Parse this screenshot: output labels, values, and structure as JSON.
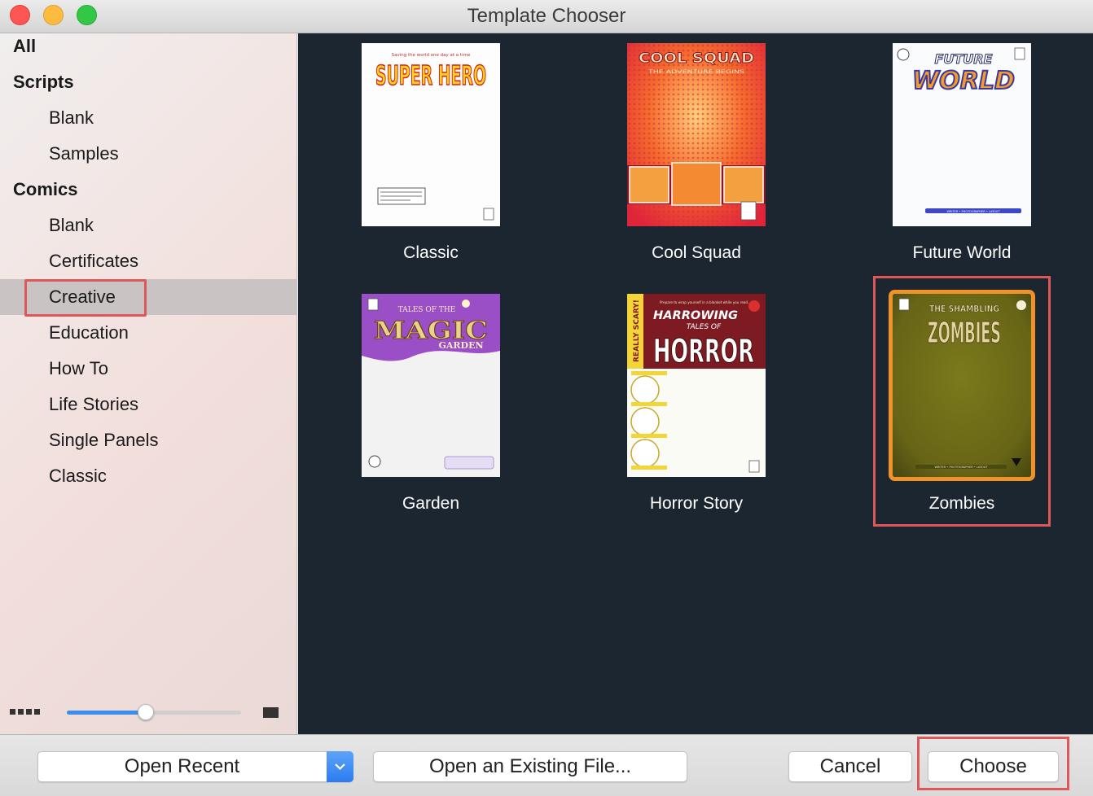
{
  "window": {
    "title": "Template Chooser"
  },
  "sidebar": {
    "items": [
      {
        "label": "All",
        "level": "header",
        "selected": false
      },
      {
        "label": "Scripts",
        "level": "header",
        "selected": false
      },
      {
        "label": "Blank",
        "level": "child",
        "selected": false
      },
      {
        "label": "Samples",
        "level": "child",
        "selected": false
      },
      {
        "label": "Comics",
        "level": "header",
        "selected": false
      },
      {
        "label": "Blank",
        "level": "child",
        "selected": false
      },
      {
        "label": "Certificates",
        "level": "child",
        "selected": false
      },
      {
        "label": "Creative",
        "level": "child",
        "selected": true
      },
      {
        "label": "Education",
        "level": "child",
        "selected": false
      },
      {
        "label": "How To",
        "level": "child",
        "selected": false
      },
      {
        "label": "Life Stories",
        "level": "child",
        "selected": false
      },
      {
        "label": "Single Panels",
        "level": "child",
        "selected": false
      },
      {
        "label": "Classic",
        "level": "child",
        "selected": false
      }
    ],
    "size_slider": {
      "value": 0.45
    }
  },
  "templates": [
    {
      "label": "Classic",
      "cover_text": [
        "Saving the world one day at a time",
        "SUPER HERO"
      ],
      "selected": false
    },
    {
      "label": "Cool Squad",
      "cover_text": [
        "COOL SQUAD",
        "THE ADVENTURE BEGINS"
      ],
      "selected": false
    },
    {
      "label": "Future World",
      "cover_text": [
        "FUTURE",
        "WORLD",
        "WRITER • PHOTOGRAPHER • LAYOUT"
      ],
      "selected": false
    },
    {
      "label": "Garden",
      "cover_text": [
        "TALES OF THE",
        "MAGIC",
        "GARDEN"
      ],
      "selected": false
    },
    {
      "label": "Horror Story",
      "cover_text": [
        "Prepare to wrap yourself in a blanket while you read...",
        "HARROWING",
        "TALES OF",
        "HORROR",
        "REALLY SCARY!"
      ],
      "selected": false
    },
    {
      "label": "Zombies",
      "cover_text": [
        "THE SHAMBLING",
        "ZOMBIES",
        "WRITER • PHOTOGRAPHER • LAYOUT"
      ],
      "selected": true
    }
  ],
  "footer": {
    "open_recent": "Open Recent",
    "open_existing": "Open an Existing File...",
    "cancel": "Cancel",
    "choose": "Choose"
  },
  "colors": {
    "gallery_bg": "#1c2630",
    "selection_ring": "#f0922a",
    "highlight_box": "#e0575a",
    "accent_blue": "#2b7cf0"
  }
}
